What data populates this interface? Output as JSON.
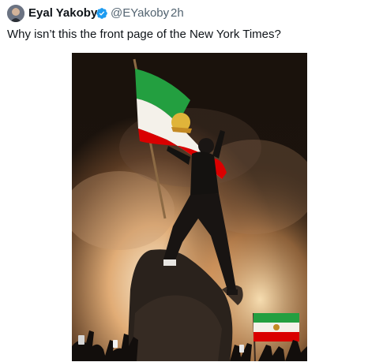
{
  "tweet": {
    "author_name": "Eyal Yakoby",
    "verified_icon": "verified-badge-icon",
    "handle": "@EYakoby",
    "separator": "·",
    "time": "2h",
    "text": "Why isn’t this the front page of the New York Times?",
    "media": {
      "kind": "photo",
      "subject_icon": "protest-photo"
    }
  },
  "colors": {
    "text_primary": "#0f1419",
    "text_secondary": "#536471",
    "verified_blue": "#1d9bf0",
    "flag_green": "#239f40",
    "flag_white": "#ffffff",
    "flag_red": "#da0000"
  }
}
